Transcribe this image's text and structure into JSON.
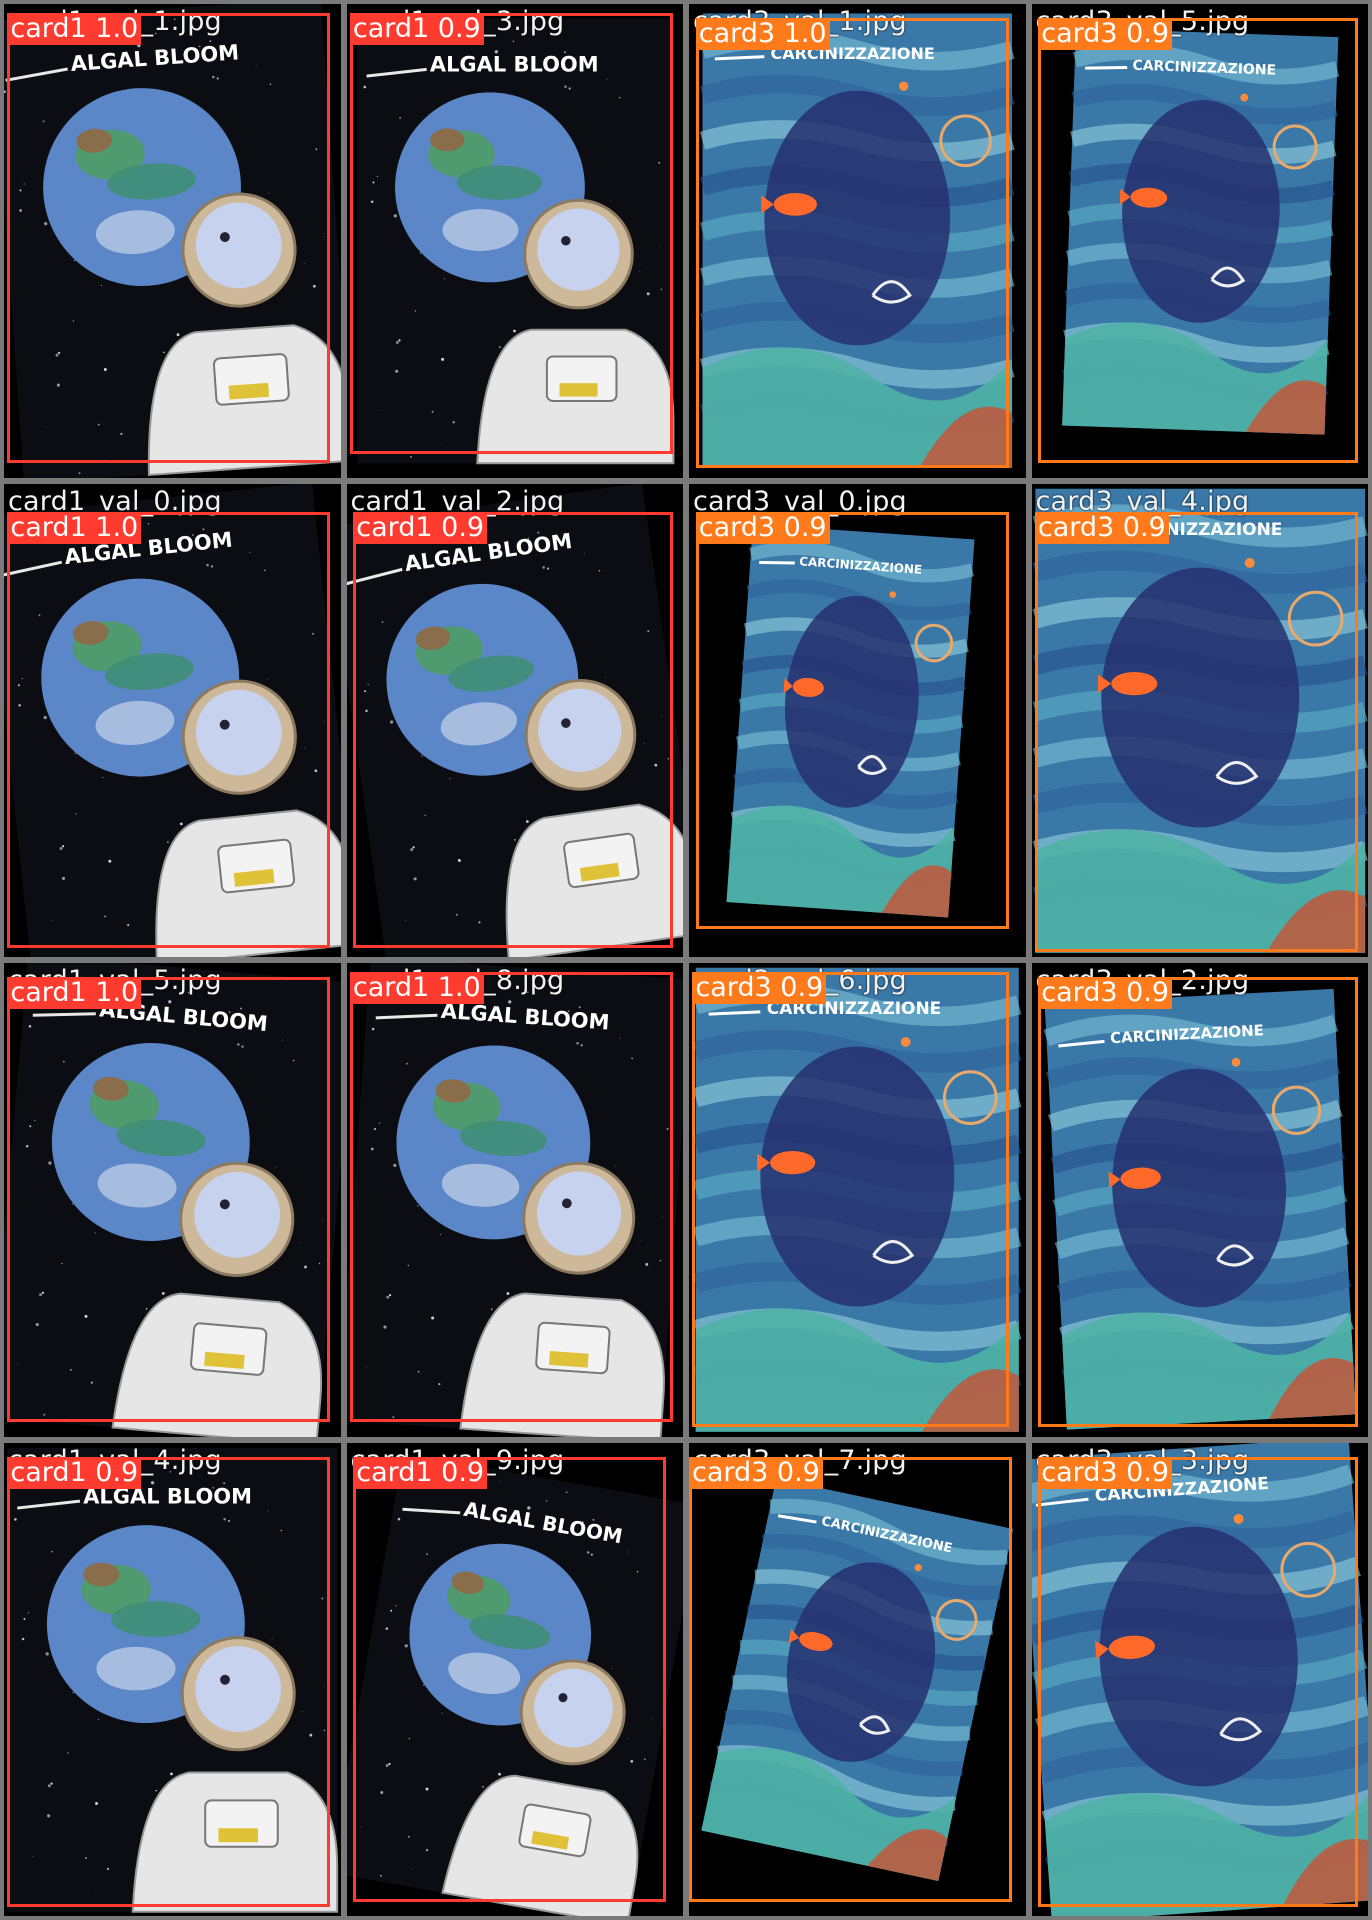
{
  "colors": {
    "card1": "#ff3b30",
    "card3": "#ff7a1a"
  },
  "tiles": [
    {
      "filename": "card1_val_1.jpg",
      "cls": "card1",
      "score": "1.0",
      "label": "card1 1.0",
      "title": "ALGAL BLOOM",
      "art": "astro"
    },
    {
      "filename": "card1_val_3.jpg",
      "cls": "card1",
      "score": "0.9",
      "label": "card1 0.9",
      "title": "ALGAL BLOOM",
      "art": "astro"
    },
    {
      "filename": "card3_val_1.jpg",
      "cls": "card3",
      "score": "1.0",
      "label": "card3 1.0",
      "title": "CARCINIZZAZIONE",
      "art": "sea"
    },
    {
      "filename": "card3_val_5.jpg",
      "cls": "card3",
      "score": "0.9",
      "label": "card3 0.9",
      "title": "CARCINIZZAZIONE",
      "art": "sea"
    },
    {
      "filename": "card1_val_0.jpg",
      "cls": "card1",
      "score": "1.0",
      "label": "card1 1.0",
      "title": "ALGAL BLOOM",
      "art": "astro"
    },
    {
      "filename": "card1_val_2.jpg",
      "cls": "card1",
      "score": "0.9",
      "label": "card1 0.9",
      "title": "ALGAL BLOOM",
      "art": "astro"
    },
    {
      "filename": "card3_val_0.jpg",
      "cls": "card3",
      "score": "0.9",
      "label": "card3 0.9",
      "title": "CARCINIZZAZIONE",
      "art": "sea"
    },
    {
      "filename": "card3_val_4.jpg",
      "cls": "card3",
      "score": "0.9",
      "label": "card3 0.9",
      "title": "CARCINIZZAZIONE",
      "art": "sea"
    },
    {
      "filename": "card1_val_5.jpg",
      "cls": "card1",
      "score": "1.0",
      "label": "card1 1.0",
      "title": "ALGAL BLOOM",
      "art": "astro"
    },
    {
      "filename": "card1_val_8.jpg",
      "cls": "card1",
      "score": "1.0",
      "label": "card1 1.0",
      "title": "ALGAL BLOOM",
      "art": "astro"
    },
    {
      "filename": "card3_val_6.jpg",
      "cls": "card3",
      "score": "0.9",
      "label": "card3 0.9",
      "title": "CARCINIZZAZIONE",
      "art": "sea"
    },
    {
      "filename": "card3_val_2.jpg",
      "cls": "card3",
      "score": "0.9",
      "label": "card3 0.9",
      "title": "CARCINIZZAZIONE",
      "art": "sea"
    },
    {
      "filename": "card1_val_4.jpg",
      "cls": "card1",
      "score": "0.9",
      "label": "card1 0.9",
      "title": "ALGAL BLOOM",
      "art": "astro"
    },
    {
      "filename": "card1_val_9.jpg",
      "cls": "card1",
      "score": "0.9",
      "label": "card1 0.9",
      "title": "ALGAL BLOOM",
      "art": "astro"
    },
    {
      "filename": "card3_val_7.jpg",
      "cls": "card3",
      "score": "0.9",
      "label": "card3 0.9",
      "title": "CARCINIZZAZIONE",
      "art": "sea"
    },
    {
      "filename": "card3_val_3.jpg",
      "cls": "card3",
      "score": "0.9",
      "label": "card3 0.9",
      "title": "CARCINIZZAZIONE",
      "art": "sea"
    }
  ]
}
